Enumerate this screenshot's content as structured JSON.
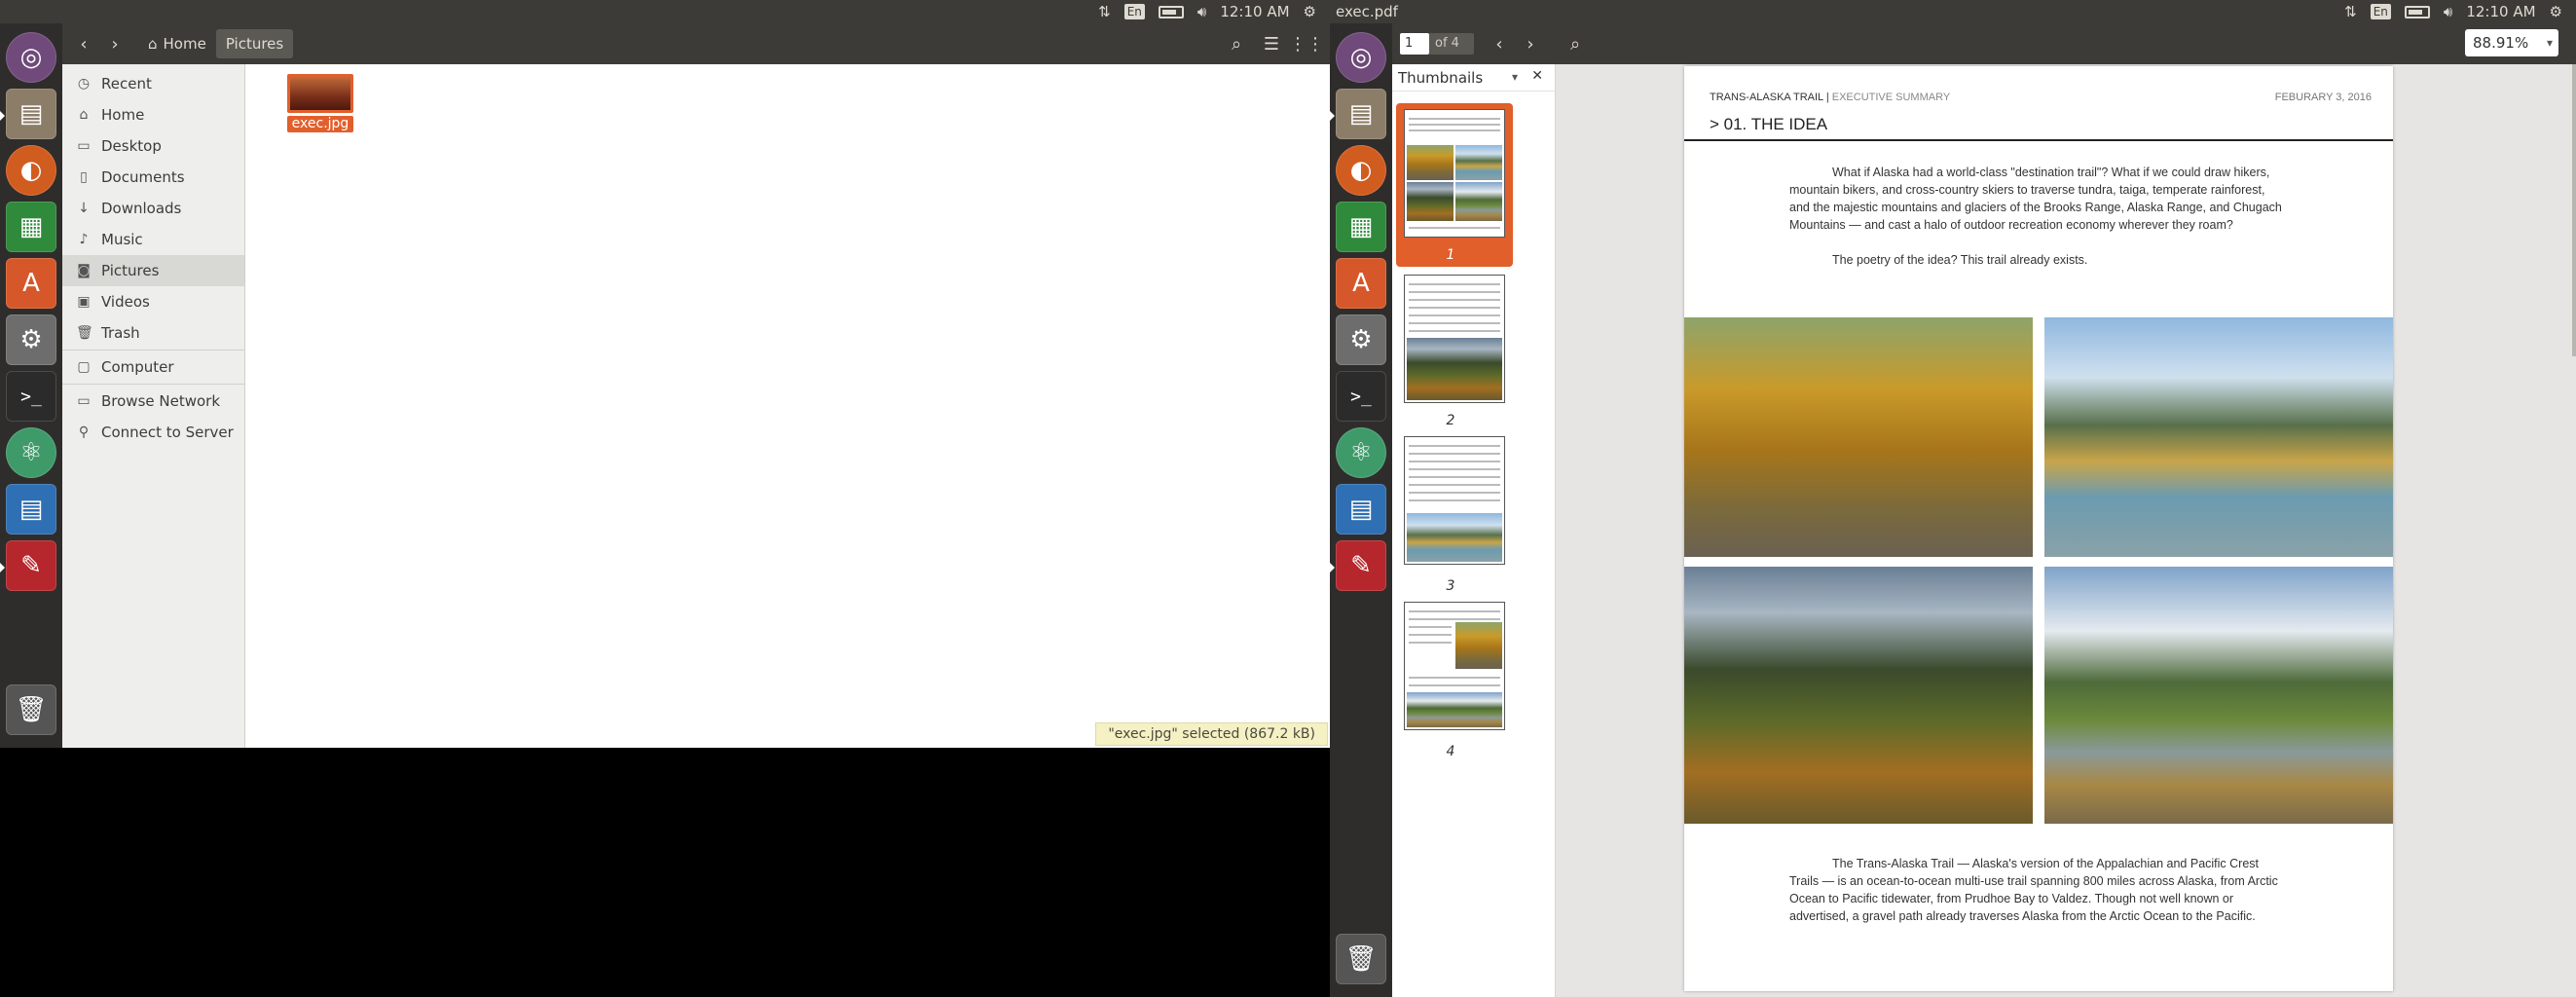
{
  "left_screen": {
    "panel": {
      "lang": "En",
      "time": "12:10 AM"
    },
    "launcher": [
      {
        "name": "dash-icon",
        "glyph": "◉"
      },
      {
        "name": "files-icon",
        "glyph": "▤"
      },
      {
        "name": "firefox-icon",
        "glyph": "●"
      },
      {
        "name": "calc-icon",
        "glyph": "▦"
      },
      {
        "name": "software-center-icon",
        "glyph": "A"
      },
      {
        "name": "settings-icon",
        "glyph": "⚙"
      },
      {
        "name": "terminal-icon",
        "glyph": ">_"
      },
      {
        "name": "atom-icon",
        "glyph": "⚛"
      },
      {
        "name": "writer-icon",
        "glyph": "▤"
      },
      {
        "name": "evince-icon",
        "glyph": "✎"
      }
    ],
    "file_manager": {
      "breadcrumb": {
        "home": "Home",
        "current": "Pictures"
      },
      "sidebar": [
        "Recent",
        "Home",
        "Desktop",
        "Documents",
        "Downloads",
        "Music",
        "Pictures",
        "Videos",
        "Trash",
        "Computer",
        "Browse Network",
        "Connect to Server"
      ],
      "files": [
        {
          "name": "exec.jpg"
        }
      ],
      "status": "\"exec.jpg\" selected  (867.2 kB)"
    }
  },
  "right_screen": {
    "panel": {
      "title": "exec.pdf",
      "lang": "En",
      "time": "12:10 AM"
    },
    "viewer": {
      "page_field": "1",
      "page_of": "of 4",
      "zoom": "88.91%",
      "sidebar_title": "Thumbnails",
      "thumbnails": [
        "1",
        "2",
        "3",
        "4"
      ],
      "page": {
        "header_left_main": "TRANS-ALASKA TRAIL |",
        "header_left_sub": "EXECUTIVE SUMMARY",
        "header_right": "FEBURARY 3, 2016",
        "title": "> 01. THE IDEA",
        "para1": "What if Alaska had a world-class \"destination trail\"? What if we could draw hikers, mountain bikers, and cross-country skiers to traverse tundra, taiga, temperate rainforest, and the majestic mountains and glaciers of the Brooks Range, Alaska Range, and Chugach Mountains — and cast a halo of outdoor recreation economy wherever they roam?",
        "para2": "The poetry of the idea? This trail already exists.",
        "para3": "The Trans-Alaska Trail — Alaska's version of the Appalachian and Pacific Crest Trails — is an ocean-to-ocean multi-use trail spanning 800 miles across Alaska, from Arctic Ocean to Pacific tidewater, from Prudhoe Bay to Valdez. Though not well known or advertised, a gravel path already traverses Alaska from the Arctic Ocean to the Pacific."
      }
    }
  }
}
